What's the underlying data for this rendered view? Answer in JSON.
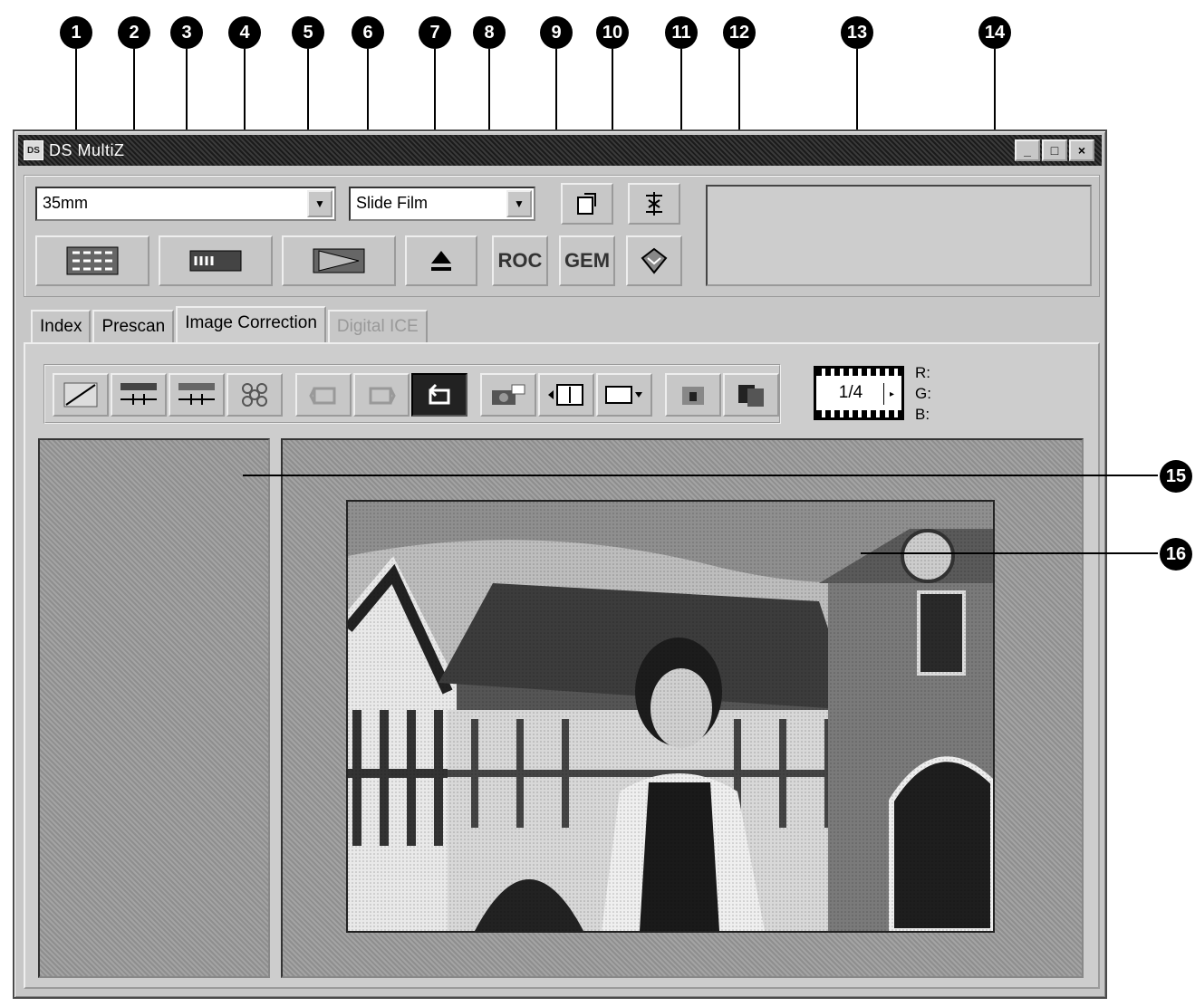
{
  "window": {
    "title": "DS MultiZ",
    "app_icon": "DS",
    "controls": {
      "minimize": "_",
      "maximize": "□",
      "close": "×"
    }
  },
  "toolbar": {
    "film_format": "35mm",
    "film_type": "Slide Film",
    "dropdown_arrow": "▼",
    "buttons": {
      "roc": "ROC",
      "gem": "GEM"
    }
  },
  "tabs": [
    {
      "label": "Index"
    },
    {
      "label": "Prescan"
    },
    {
      "label": "Image Correction"
    },
    {
      "label": "Digital ICE"
    }
  ],
  "tools": [
    {
      "icon": "curves-icon"
    },
    {
      "icon": "brightness-contrast-icon"
    },
    {
      "icon": "color-balance-icon"
    },
    {
      "icon": "variations-icon"
    },
    {
      "icon": "undo-icon"
    },
    {
      "icon": "redo-icon"
    },
    {
      "icon": "reset-icon"
    },
    {
      "icon": "snapshot-icon"
    },
    {
      "icon": "compare-icon"
    },
    {
      "icon": "display-mode-icon"
    },
    {
      "icon": "clip-icon"
    },
    {
      "icon": "split-view-icon"
    }
  ],
  "frame_counter": {
    "value": "1/4",
    "next": "▸"
  },
  "rgb_readout": {
    "r": "R:",
    "g": "G:",
    "b": "B:"
  },
  "callouts": [
    "1",
    "2",
    "3",
    "4",
    "5",
    "6",
    "7",
    "8",
    "9",
    "10",
    "11",
    "12",
    "13",
    "14",
    "15",
    "16"
  ]
}
